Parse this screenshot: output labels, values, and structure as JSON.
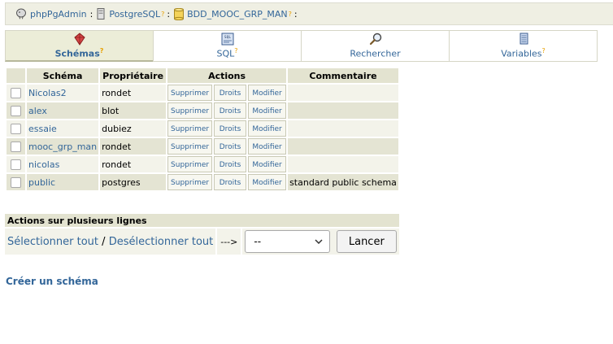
{
  "breadcrumb": [
    {
      "label": "phpPgAdmin",
      "help": "",
      "sep": ":"
    },
    {
      "label": "PostgreSQL",
      "help": "?",
      "sep": ":"
    },
    {
      "label": "BDD_MOOC_GRP_MAN",
      "help": "?",
      "sep": ":"
    }
  ],
  "tabs": [
    {
      "label": "Schémas",
      "help": "?",
      "icon": "schemas-icon",
      "active": true
    },
    {
      "label": "SQL",
      "help": "?",
      "icon": "sql-icon",
      "active": false
    },
    {
      "label": "Rechercher",
      "help": "",
      "icon": "search-icon",
      "active": false
    },
    {
      "label": "Variables",
      "help": "?",
      "icon": "variables-icon",
      "active": false
    }
  ],
  "table": {
    "headers": [
      "Schéma",
      "Propriétaire",
      "Actions",
      "Commentaire"
    ],
    "action_labels": [
      "Supprimer",
      "Droits",
      "Modifier"
    ],
    "rows": [
      {
        "schema": "Nicolas2",
        "owner": "rondet",
        "comment": ""
      },
      {
        "schema": "alex",
        "owner": "blot",
        "comment": ""
      },
      {
        "schema": "essaie",
        "owner": "dubiez",
        "comment": ""
      },
      {
        "schema": "mooc_grp_man",
        "owner": "rondet",
        "comment": ""
      },
      {
        "schema": "nicolas",
        "owner": "rondet",
        "comment": ""
      },
      {
        "schema": "public",
        "owner": "postgres",
        "comment": "standard public schema"
      }
    ]
  },
  "multi_actions": {
    "title": "Actions sur plusieurs lignes",
    "select_all": "Sélectionner tout",
    "separator": "/",
    "deselect_all": "Desélectionner tout",
    "arrow": "--->",
    "select_value": "--",
    "cancel": "Lancer"
  },
  "create_link": "Créer un schéma",
  "colors": {
    "link": "#336699",
    "header_bg": "#e3e3d0",
    "row_light": "#f3f3ea",
    "row_dark": "#e4e4d3",
    "help": "#e8a000"
  }
}
